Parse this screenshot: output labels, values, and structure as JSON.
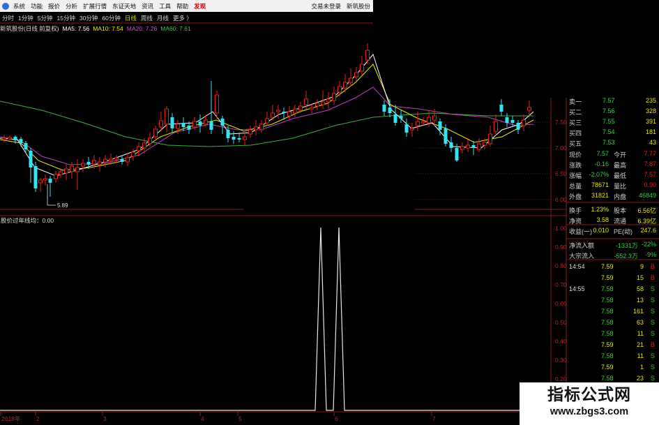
{
  "menubar": {
    "items": [
      "系统",
      "功能",
      "报价",
      "分析",
      "扩展行情",
      "东证天地",
      "资讯",
      "工具",
      "帮助",
      "发现"
    ],
    "right": [
      "交易未登录",
      "新筑股份"
    ]
  },
  "periods": [
    "分时",
    "1分钟",
    "5分钟",
    "15分钟",
    "30分钟",
    "60分钟",
    "日线",
    "周线",
    "月线",
    "更多 〉"
  ],
  "ma_legend": {
    "title": "新筑股份(日线 前复权)",
    "ma5": "MA5: 7.56",
    "ma10": "MA10: 7.54",
    "ma20": "MA20: 7.26",
    "ma60": "MA60: 7.61"
  },
  "colors": {
    "up": "#e8201c",
    "down": "#33e3ef",
    "ma5": "#ffffff",
    "ma10": "#eded00",
    "ma20": "#c040c0",
    "ma60": "#3ab03a",
    "grid": "#8c1a1c"
  },
  "price_axis": [
    "7.50",
    "7.00",
    "6.50",
    "6.00"
  ],
  "low_marker": "5.89",
  "indicator_legend": "股价过年线均：0.00",
  "ind_axis": [
    "1.00",
    "0.90",
    "0.80",
    "0.70",
    "0.60",
    "0.50",
    "0.40",
    "0.30",
    "0.20",
    "0.10"
  ],
  "x_axis": [
    "2018年",
    "2",
    "3",
    "4",
    "5",
    "6",
    "7"
  ],
  "order_book": [
    {
      "label": "卖一",
      "price": "7.57",
      "vol": "235"
    },
    {
      "label": "买二",
      "price": "7.56",
      "vol": "328"
    },
    {
      "label": "买三",
      "price": "7.55",
      "vol": "391"
    },
    {
      "label": "买四",
      "price": "7.54",
      "vol": "181"
    },
    {
      "label": "买五",
      "price": "7.53",
      "vol": "43"
    }
  ],
  "quote": [
    {
      "l1": "现价",
      "v1": "7.57",
      "l2": "今开",
      "v2": "7.77"
    },
    {
      "l1": "涨跌",
      "v1": "-0.16",
      "l2": "最高",
      "v2": "7.87"
    },
    {
      "l1": "涨幅",
      "v1": "-2.07%",
      "l2": "最低",
      "v2": "7.57"
    },
    {
      "l1": "总量",
      "v1": "78671",
      "l2": "量比",
      "v2": "0.90"
    },
    {
      "l1": "外盘",
      "v1": "31821",
      "l2": "内盘",
      "v2": "46849"
    }
  ],
  "stats": [
    {
      "l1": "换手",
      "v1": "1.23%",
      "l2": "股本",
      "v2": "6.56亿"
    },
    {
      "l1": "净资",
      "v1": "3.58",
      "l2": "流通",
      "v2": "6.39亿"
    },
    {
      "l1": "收益(一)",
      "v1": "0.010",
      "l2": "PE(动)",
      "v2": "247.6"
    }
  ],
  "flow": [
    {
      "label": "净流入额",
      "v1": "-1331万",
      "v2": "-22%"
    },
    {
      "label": "大宗流入",
      "v1": "-552.3万",
      "v2": "-9%"
    }
  ],
  "ticks": [
    {
      "time": "14:54",
      "price": "7.59",
      "vol": "9",
      "side": "B"
    },
    {
      "time": "",
      "price": "7.59",
      "vol": "15",
      "side": "B"
    },
    {
      "time": "14:55",
      "price": "7.58",
      "vol": "58",
      "side": "S"
    },
    {
      "time": "",
      "price": "7.58",
      "vol": "13",
      "side": "S"
    },
    {
      "time": "",
      "price": "7.58",
      "vol": "161",
      "side": "S"
    },
    {
      "time": "",
      "price": "7.58",
      "vol": "63",
      "side": "S"
    },
    {
      "time": "",
      "price": "7.58",
      "vol": "11",
      "side": "S"
    },
    {
      "time": "",
      "price": "7.59",
      "vol": "21",
      "side": "B"
    },
    {
      "time": "",
      "price": "7.58",
      "vol": "11",
      "side": "S"
    },
    {
      "time": "",
      "price": "7.59",
      "vol": "1",
      "side": "S"
    },
    {
      "time": "",
      "price": "7.58",
      "vol": "23",
      "side": "S"
    },
    {
      "time": "",
      "price": "7.59",
      "vol": "6",
      "side": "B"
    }
  ],
  "watermark": {
    "line1": "指标公式网",
    "line2": "www.zbgs3.com"
  }
}
